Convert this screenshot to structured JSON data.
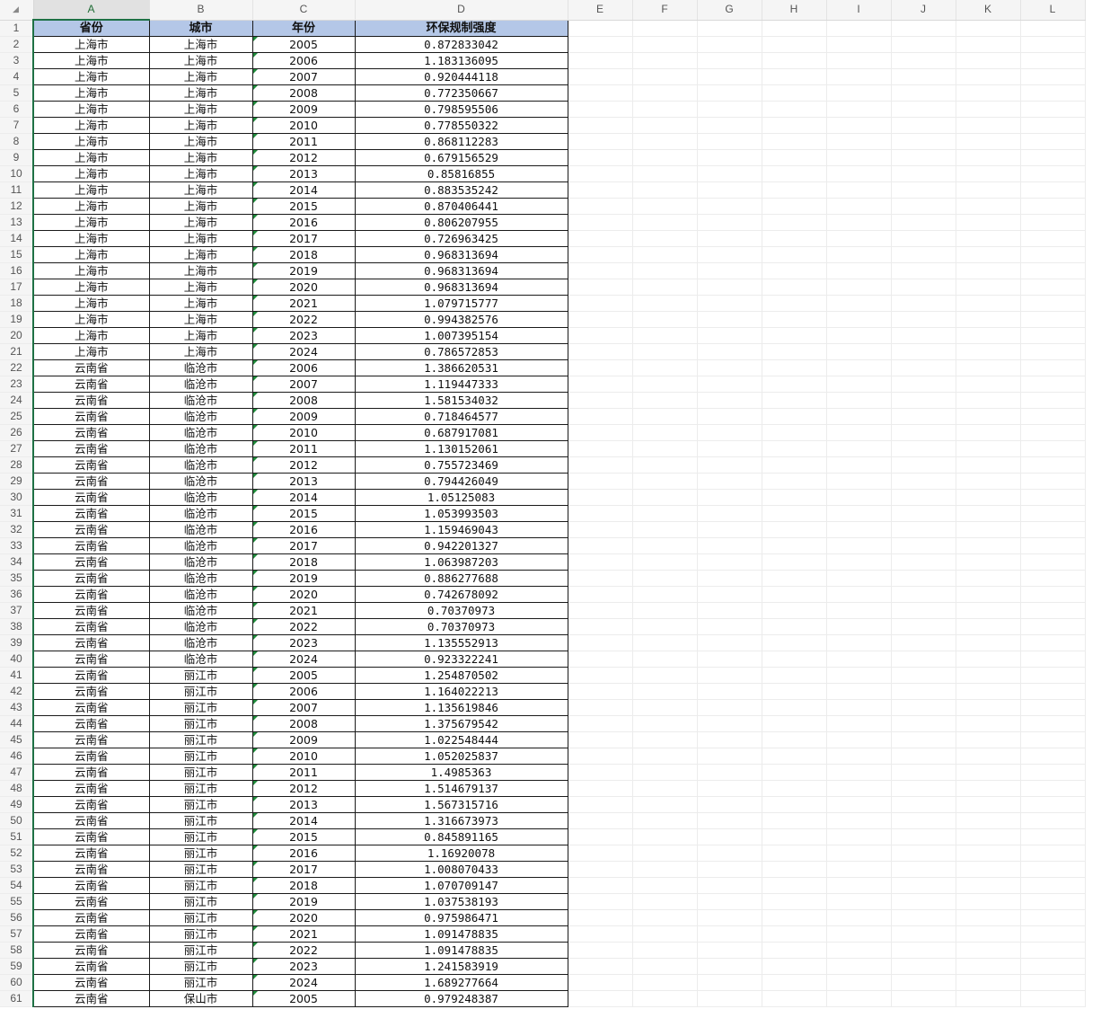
{
  "corner_label": "◢",
  "columns": [
    "A",
    "B",
    "C",
    "D",
    "E",
    "F",
    "G",
    "H",
    "I",
    "J",
    "K",
    "L"
  ],
  "selected_column": "A",
  "header": {
    "province": "省份",
    "city": "城市",
    "year": "年份",
    "intensity": "环保规制强度"
  },
  "rows": [
    [
      "上海市",
      "上海市",
      "2005",
      "0.872833042"
    ],
    [
      "上海市",
      "上海市",
      "2006",
      "1.183136095"
    ],
    [
      "上海市",
      "上海市",
      "2007",
      "0.920444118"
    ],
    [
      "上海市",
      "上海市",
      "2008",
      "0.772350667"
    ],
    [
      "上海市",
      "上海市",
      "2009",
      "0.798595506"
    ],
    [
      "上海市",
      "上海市",
      "2010",
      "0.778550322"
    ],
    [
      "上海市",
      "上海市",
      "2011",
      "0.868112283"
    ],
    [
      "上海市",
      "上海市",
      "2012",
      "0.679156529"
    ],
    [
      "上海市",
      "上海市",
      "2013",
      "0.85816855"
    ],
    [
      "上海市",
      "上海市",
      "2014",
      "0.883535242"
    ],
    [
      "上海市",
      "上海市",
      "2015",
      "0.870406441"
    ],
    [
      "上海市",
      "上海市",
      "2016",
      "0.806207955"
    ],
    [
      "上海市",
      "上海市",
      "2017",
      "0.726963425"
    ],
    [
      "上海市",
      "上海市",
      "2018",
      "0.968313694"
    ],
    [
      "上海市",
      "上海市",
      "2019",
      "0.968313694"
    ],
    [
      "上海市",
      "上海市",
      "2020",
      "0.968313694"
    ],
    [
      "上海市",
      "上海市",
      "2021",
      "1.079715777"
    ],
    [
      "上海市",
      "上海市",
      "2022",
      "0.994382576"
    ],
    [
      "上海市",
      "上海市",
      "2023",
      "1.007395154"
    ],
    [
      "上海市",
      "上海市",
      "2024",
      "0.786572853"
    ],
    [
      "云南省",
      "临沧市",
      "2006",
      "1.386620531"
    ],
    [
      "云南省",
      "临沧市",
      "2007",
      "1.119447333"
    ],
    [
      "云南省",
      "临沧市",
      "2008",
      "1.581534032"
    ],
    [
      "云南省",
      "临沧市",
      "2009",
      "0.718464577"
    ],
    [
      "云南省",
      "临沧市",
      "2010",
      "0.687917081"
    ],
    [
      "云南省",
      "临沧市",
      "2011",
      "1.130152061"
    ],
    [
      "云南省",
      "临沧市",
      "2012",
      "0.755723469"
    ],
    [
      "云南省",
      "临沧市",
      "2013",
      "0.794426049"
    ],
    [
      "云南省",
      "临沧市",
      "2014",
      "1.05125083"
    ],
    [
      "云南省",
      "临沧市",
      "2015",
      "1.053993503"
    ],
    [
      "云南省",
      "临沧市",
      "2016",
      "1.159469043"
    ],
    [
      "云南省",
      "临沧市",
      "2017",
      "0.942201327"
    ],
    [
      "云南省",
      "临沧市",
      "2018",
      "1.063987203"
    ],
    [
      "云南省",
      "临沧市",
      "2019",
      "0.886277688"
    ],
    [
      "云南省",
      "临沧市",
      "2020",
      "0.742678092"
    ],
    [
      "云南省",
      "临沧市",
      "2021",
      "0.70370973"
    ],
    [
      "云南省",
      "临沧市",
      "2022",
      "0.70370973"
    ],
    [
      "云南省",
      "临沧市",
      "2023",
      "1.135552913"
    ],
    [
      "云南省",
      "临沧市",
      "2024",
      "0.923322241"
    ],
    [
      "云南省",
      "丽江市",
      "2005",
      "1.254870502"
    ],
    [
      "云南省",
      "丽江市",
      "2006",
      "1.164022213"
    ],
    [
      "云南省",
      "丽江市",
      "2007",
      "1.135619846"
    ],
    [
      "云南省",
      "丽江市",
      "2008",
      "1.375679542"
    ],
    [
      "云南省",
      "丽江市",
      "2009",
      "1.022548444"
    ],
    [
      "云南省",
      "丽江市",
      "2010",
      "1.052025837"
    ],
    [
      "云南省",
      "丽江市",
      "2011",
      "1.4985363"
    ],
    [
      "云南省",
      "丽江市",
      "2012",
      "1.514679137"
    ],
    [
      "云南省",
      "丽江市",
      "2013",
      "1.567315716"
    ],
    [
      "云南省",
      "丽江市",
      "2014",
      "1.316673973"
    ],
    [
      "云南省",
      "丽江市",
      "2015",
      "0.845891165"
    ],
    [
      "云南省",
      "丽江市",
      "2016",
      "1.16920078"
    ],
    [
      "云南省",
      "丽江市",
      "2017",
      "1.008070433"
    ],
    [
      "云南省",
      "丽江市",
      "2018",
      "1.070709147"
    ],
    [
      "云南省",
      "丽江市",
      "2019",
      "1.037538193"
    ],
    [
      "云南省",
      "丽江市",
      "2020",
      "0.975986471"
    ],
    [
      "云南省",
      "丽江市",
      "2021",
      "1.091478835"
    ],
    [
      "云南省",
      "丽江市",
      "2022",
      "1.091478835"
    ],
    [
      "云南省",
      "丽江市",
      "2023",
      "1.241583919"
    ],
    [
      "云南省",
      "丽江市",
      "2024",
      "1.689277664"
    ],
    [
      "云南省",
      "保山市",
      "2005",
      "0.979248387"
    ]
  ]
}
